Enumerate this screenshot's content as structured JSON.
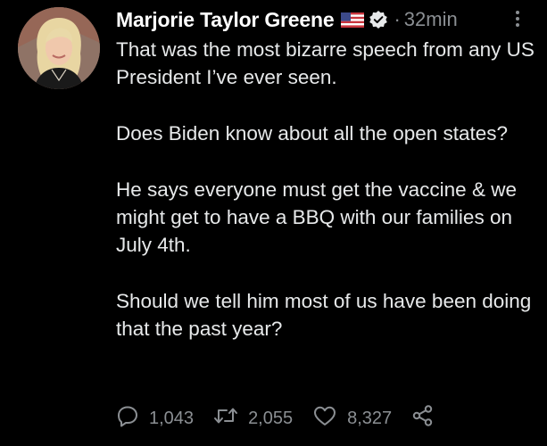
{
  "tweet": {
    "author_name": "Marjorie Taylor Greene",
    "separator": "·",
    "timestamp": "32min",
    "paragraphs": [
      "That was the most bizarre speech from any US President I’ve ever seen.",
      "Does Biden know about all the open states?",
      "He says everyone must get the vaccine & we might get to have a BBQ with our families on July 4th.",
      "Should we tell him most of us have been doing that the past year?"
    ],
    "replies": "1,043",
    "retweets": "2,055",
    "likes": "8,327"
  },
  "icons": {
    "flag": "us-flag-icon",
    "verified": "verified-badge-icon",
    "more": "more-options-icon",
    "reply": "reply-icon",
    "retweet": "retweet-icon",
    "like": "like-icon",
    "share": "share-icon"
  },
  "colors": {
    "background": "#000000",
    "text": "#e7e9ea",
    "secondary": "#8b8f93"
  }
}
